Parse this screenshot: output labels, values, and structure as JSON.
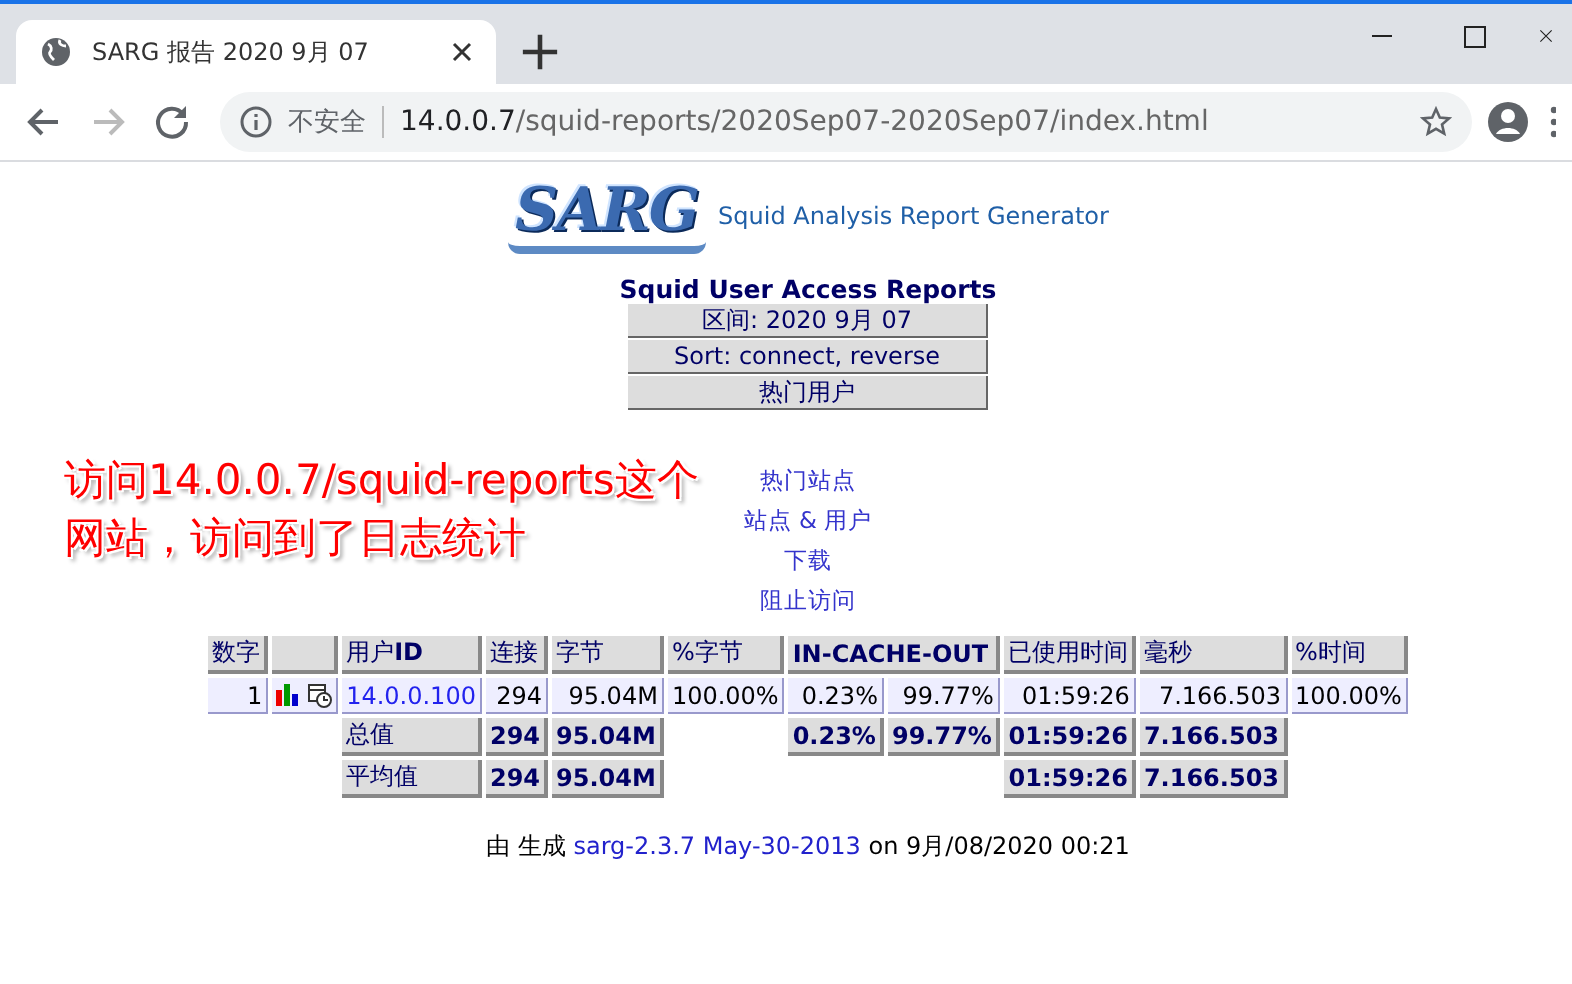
{
  "browser": {
    "tab_title": "SARG 报告 2020 9月 07",
    "security": "不安全",
    "url_host": "14.0.0.7",
    "url_path": "/squid-reports/2020Sep07-2020Sep07/index.html"
  },
  "header": {
    "logo": "SARG",
    "subtitle": "Squid Analysis Report Generator"
  },
  "report": {
    "title": "Squid User Access Reports",
    "info": [
      "区间: 2020 9月 07",
      "Sort: connect, reverse",
      "热门用户"
    ]
  },
  "nav_links": [
    "热门站点",
    "站点 & 用户",
    "下载",
    "阻止访问"
  ],
  "annotation": [
    "访问14.0.0.7/squid-reports这个",
    "网站，访问到了日志统计"
  ],
  "table": {
    "columns": [
      {
        "kind": "text",
        "label": "数字"
      },
      {
        "kind": "blank"
      },
      {
        "kind": "text",
        "label": "用户**ID**"
      },
      {
        "kind": "text",
        "label": "连接"
      },
      {
        "kind": "text",
        "label": "字节"
      },
      {
        "kind": "text",
        "label": "%字节"
      },
      {
        "kind": "text",
        "label": "IN-CACHE-OUT",
        "colspan": 2
      },
      {
        "kind": "text",
        "label": "已使用时间"
      },
      {
        "kind": "text",
        "label": "毫秒"
      },
      {
        "kind": "text",
        "label": "%时间"
      }
    ],
    "rows": [
      {
        "kind": "user",
        "cells": [
          {
            "kind": "num",
            "text": "1"
          },
          {
            "kind": "icons"
          },
          {
            "kind": "link",
            "text": "14.0.0.100"
          },
          {
            "kind": "value",
            "text": "294"
          },
          {
            "kind": "value",
            "text": "95.04M"
          },
          {
            "kind": "value",
            "text": "100.00%"
          },
          {
            "kind": "value",
            "text": "0.23%"
          },
          {
            "kind": "value",
            "text": "99.77%"
          },
          {
            "kind": "value",
            "text": "01:59:26"
          },
          {
            "kind": "value",
            "text": "7.166.503"
          },
          {
            "kind": "value",
            "text": "100.00%"
          }
        ]
      },
      {
        "kind": "summary",
        "cells": [
          {
            "kind": "blank"
          },
          {
            "kind": "blank"
          },
          {
            "kind": "label",
            "text": "总值"
          },
          {
            "kind": "value",
            "text": "294"
          },
          {
            "kind": "value",
            "text": "95.04M"
          },
          {
            "kind": "blank"
          },
          {
            "kind": "value",
            "text": "0.23%"
          },
          {
            "kind": "value",
            "text": "99.77%"
          },
          {
            "kind": "value",
            "text": "01:59:26"
          },
          {
            "kind": "value",
            "text": "7.166.503"
          },
          {
            "kind": "blank"
          }
        ]
      },
      {
        "kind": "summary",
        "cells": [
          {
            "kind": "blank"
          },
          {
            "kind": "blank"
          },
          {
            "kind": "label",
            "text": "平均值"
          },
          {
            "kind": "value",
            "text": "294"
          },
          {
            "kind": "value",
            "text": "95.04M"
          },
          {
            "kind": "blank"
          },
          {
            "kind": "blank"
          },
          {
            "kind": "blank"
          },
          {
            "kind": "value",
            "text": "01:59:26"
          },
          {
            "kind": "value",
            "text": "7.166.503"
          },
          {
            "kind": "blank"
          }
        ]
      }
    ]
  },
  "footer": {
    "prefix": "由 生成",
    "link": "sarg-2.3.7 May-30-2013",
    "suffix": "on 9月/08/2020 00:21"
  }
}
